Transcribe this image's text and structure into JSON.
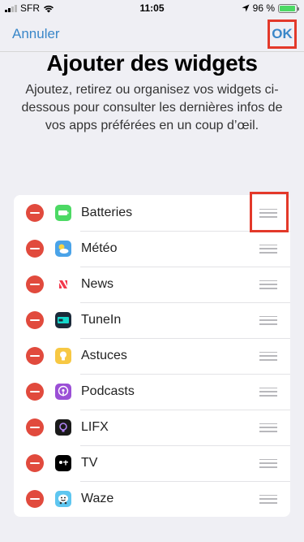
{
  "status_bar": {
    "carrier": "SFR",
    "time": "11:05",
    "battery_percent": "96 %",
    "battery_level": 0.96
  },
  "nav": {
    "cancel_label": "Annuler",
    "ok_label": "OK"
  },
  "header": {
    "title": "Ajouter des widgets",
    "description": "Ajoutez, retirez ou organisez vos widgets ci-dessous pour consulter les dernières infos de vos apps préférées en un coup d’œil."
  },
  "widgets": [
    {
      "label": "Batteries",
      "icon": "batteries-icon",
      "color": "#4cd964"
    },
    {
      "label": "Météo",
      "icon": "weather-icon",
      "color": "#4aa3e8"
    },
    {
      "label": "News",
      "icon": "news-icon",
      "color": "#ffffff"
    },
    {
      "label": "TuneIn",
      "icon": "tunein-icon",
      "color": "#1c2a3a"
    },
    {
      "label": "Astuces",
      "icon": "tips-icon",
      "color": "#f7c843"
    },
    {
      "label": "Podcasts",
      "icon": "podcasts-icon",
      "color": "#9b4fd6"
    },
    {
      "label": "LIFX",
      "icon": "lifx-icon",
      "color": "#1a1a1a"
    },
    {
      "label": "TV",
      "icon": "tv-icon",
      "color": "#000000"
    },
    {
      "label": "Waze",
      "icon": "waze-icon",
      "color": "#5ec6f0"
    }
  ],
  "colors": {
    "accent": "#3a87c9",
    "remove": "#e14a3d",
    "highlight": "#e3392a"
  }
}
